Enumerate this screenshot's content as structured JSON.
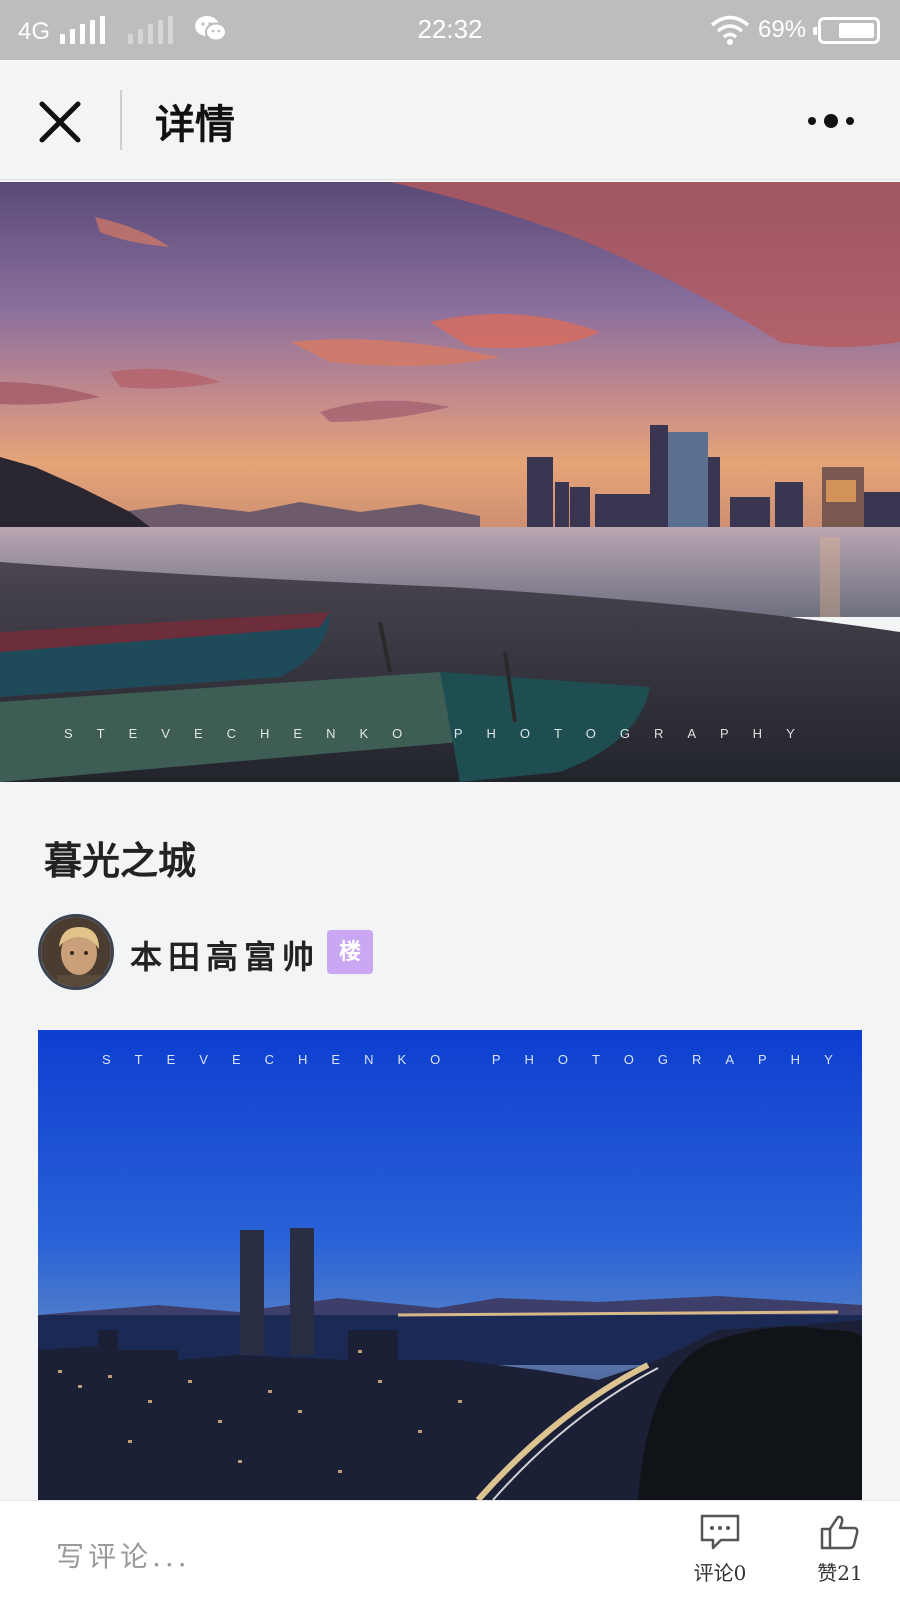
{
  "status_bar": {
    "network": "4G",
    "time": "22:32",
    "battery": "69%",
    "battery_level": 0.69,
    "icons": [
      "signal-icon",
      "wechat-icon",
      "wifi-icon",
      "battery-icon"
    ]
  },
  "nav": {
    "title": "详情",
    "icons": [
      "close-icon",
      "more-icon"
    ]
  },
  "hero": {
    "watermark": "STEVECHENKO PHOTOGRAPHY"
  },
  "post": {
    "title": "暮光之城",
    "author": "本田高富帅",
    "badge": "楼",
    "photo_watermark": "STEVECHENKO PHOTOGRAPHY"
  },
  "bottom_bar": {
    "placeholder": "写评论...",
    "comment_label": "评论0",
    "like_label": "赞21",
    "icons": [
      "comment-icon",
      "thumbs-up-icon"
    ]
  },
  "colors": {
    "status_bar": "#bdbdbd",
    "background": "#f3f4f6",
    "badge": "#c9a7f2"
  }
}
